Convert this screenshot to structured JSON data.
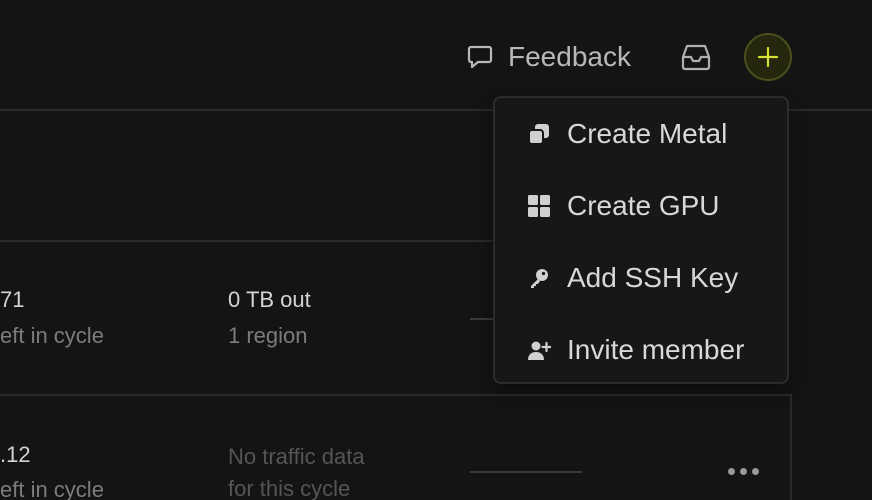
{
  "header": {
    "feedback_label": "Feedback",
    "inbox_icon": "inbox-icon",
    "create_icon": "plus-icon",
    "accent": "#d4e032"
  },
  "menu": {
    "items": [
      {
        "label": "Create Metal",
        "icon": "stacked-squares-icon"
      },
      {
        "label": "Create GPU",
        "icon": "grid-icon"
      },
      {
        "label": "Add SSH Key",
        "icon": "key-icon"
      },
      {
        "label": "Invite member",
        "icon": "user-plus-icon"
      }
    ]
  },
  "table": {
    "rows": [
      {
        "cost": "71",
        "cost_sub": "eft in cycle",
        "traffic": "0 TB out",
        "traffic_sub": "1 region"
      },
      {
        "cost": ".12",
        "cost_sub": "eft in cycle",
        "traffic": "No traffic data",
        "traffic_sub": "for this cycle"
      }
    ]
  }
}
